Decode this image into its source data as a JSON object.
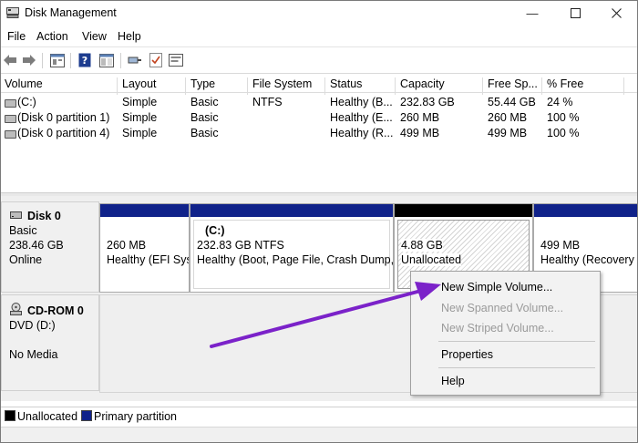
{
  "window": {
    "title": "Disk Management"
  },
  "menu": [
    "File",
    "Action",
    "View",
    "Help"
  ],
  "toolbar": {
    "icons": [
      "back-icon",
      "forward-icon",
      "properties-icon",
      "help-icon",
      "console-tree-icon",
      "connect-icon",
      "check-icon",
      "settings-icon"
    ]
  },
  "volumes": {
    "columns": [
      "Volume",
      "Layout",
      "Type",
      "File System",
      "Status",
      "Capacity",
      "Free Sp...",
      "% Free"
    ],
    "rows": [
      {
        "volume": "(C:)",
        "layout": "Simple",
        "type": "Basic",
        "fs": "NTFS",
        "status": "Healthy (B...",
        "capacity": "232.83 GB",
        "free": "55.44 GB",
        "pct": "24 %"
      },
      {
        "volume": "(Disk 0 partition 1)",
        "layout": "Simple",
        "type": "Basic",
        "fs": "",
        "status": "Healthy (E...",
        "capacity": "260 MB",
        "free": "260 MB",
        "pct": "100 %"
      },
      {
        "volume": "(Disk 0 partition 4)",
        "layout": "Simple",
        "type": "Basic",
        "fs": "",
        "status": "Healthy (R...",
        "capacity": "499 MB",
        "free": "499 MB",
        "pct": "100 %"
      }
    ]
  },
  "disk0": {
    "name": "Disk 0",
    "type": "Basic",
    "size": "238.46 GB",
    "state": "Online",
    "partitions": [
      {
        "title": "",
        "size": "260 MB",
        "status": "Healthy (EFI Sys"
      },
      {
        "title": "(C:)",
        "size": "232.83 GB NTFS",
        "status": "Healthy (Boot, Page File, Crash Dump, E"
      },
      {
        "title": "",
        "size": "4.88 GB",
        "status": "Unallocated"
      },
      {
        "title": "",
        "size": "499 MB",
        "status": "Healthy (Recovery"
      }
    ]
  },
  "cdrom0": {
    "name": "CD-ROM 0",
    "drive": "DVD (D:)",
    "media": "No Media"
  },
  "legend": {
    "unallocated": "Unallocated",
    "primary": "Primary partition"
  },
  "context_menu": {
    "new_simple": "New Simple Volume...",
    "new_spanned": "New Spanned Volume...",
    "new_striped": "New Striped Volume...",
    "properties": "Properties",
    "help": "Help"
  },
  "colors": {
    "primary_partition": "#10228a",
    "unallocated": "#000000",
    "annotation_arrow": "#7b22c9"
  }
}
